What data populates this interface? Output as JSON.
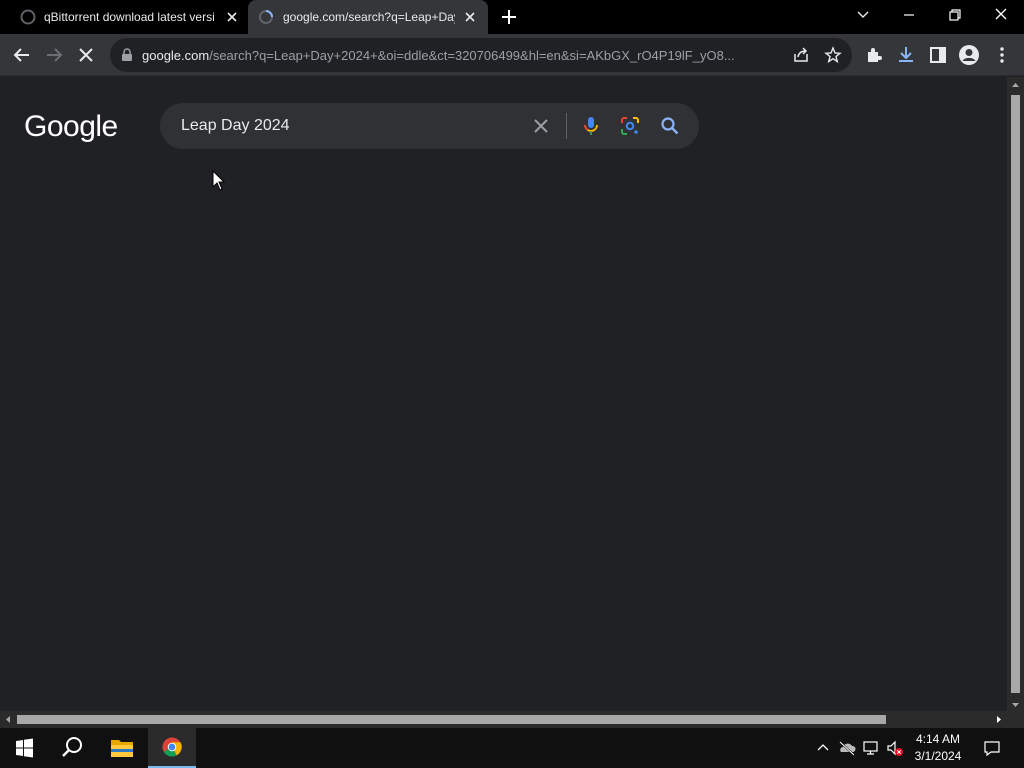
{
  "browser": {
    "tabs": [
      {
        "title": "qBittorrent download latest versi",
        "active": false
      },
      {
        "title": "google.com/search?q=Leap+Day",
        "active": true
      }
    ],
    "address": {
      "host": "google.com",
      "path": "/search?q=Leap+Day+2024+&oi=ddle&ct=320706499&hl=en&si=AKbGX_rO4P19lF_yO8..."
    }
  },
  "page": {
    "logo_text": "Google",
    "search_query": "Leap Day 2024"
  },
  "taskbar": {
    "time": "4:14 AM",
    "date": "3/1/2024"
  },
  "colors": {
    "page_background": "#202124",
    "search_box": "#303134",
    "accent_blue": "#8ab4f8"
  }
}
